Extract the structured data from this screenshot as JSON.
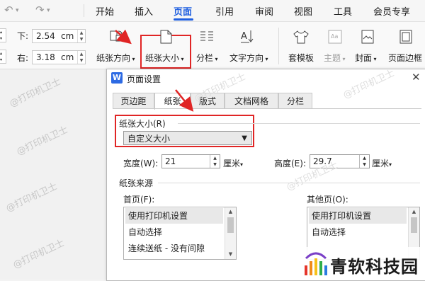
{
  "menubar": {
    "undo_icon": "undo-icon",
    "redo_icon": "redo-icon",
    "tabs": [
      "开始",
      "插入",
      "页面",
      "引用",
      "审阅",
      "视图",
      "工具",
      "会员专享"
    ],
    "active_tab": "页面"
  },
  "toolbar": {
    "margin_bottom_label": "下:",
    "margin_bottom_value": "2.54",
    "margin_right_label": "右:",
    "margin_right_value": "3.18",
    "unit": "cm",
    "buttons": [
      "纸张方向",
      "纸张大小",
      "分栏",
      "文字方向",
      "套模板",
      "主题",
      "封面",
      "页面边框"
    ],
    "highlight_button": "纸张大小"
  },
  "watermark": "@打印机卫士",
  "dialog": {
    "title": "页面设置",
    "logo_letter": "W",
    "tabs": [
      "页边距",
      "纸张",
      "版式",
      "文档网格",
      "分栏"
    ],
    "active_tab": "纸张",
    "paper_size_title": "纸张大小(R)",
    "paper_size_value": "自定义大小",
    "width_label": "宽度(W):",
    "width_value": "21",
    "height_label": "高度(E):",
    "height_value": "29.7",
    "unit": "厘米",
    "paper_source_title": "纸张来源",
    "first_page_label": "首页(F):",
    "other_pages_label": "其他页(O):",
    "first_page_items": [
      "使用打印机设置",
      "自动选择",
      "连续送纸 - 没有间隙"
    ],
    "other_page_items": [
      "使用打印机设置",
      "自动选择"
    ]
  },
  "brand": {
    "name": "青软科技园"
  },
  "colors": {
    "accent": "#1f5fe0",
    "highlight_red": "#e02525"
  }
}
